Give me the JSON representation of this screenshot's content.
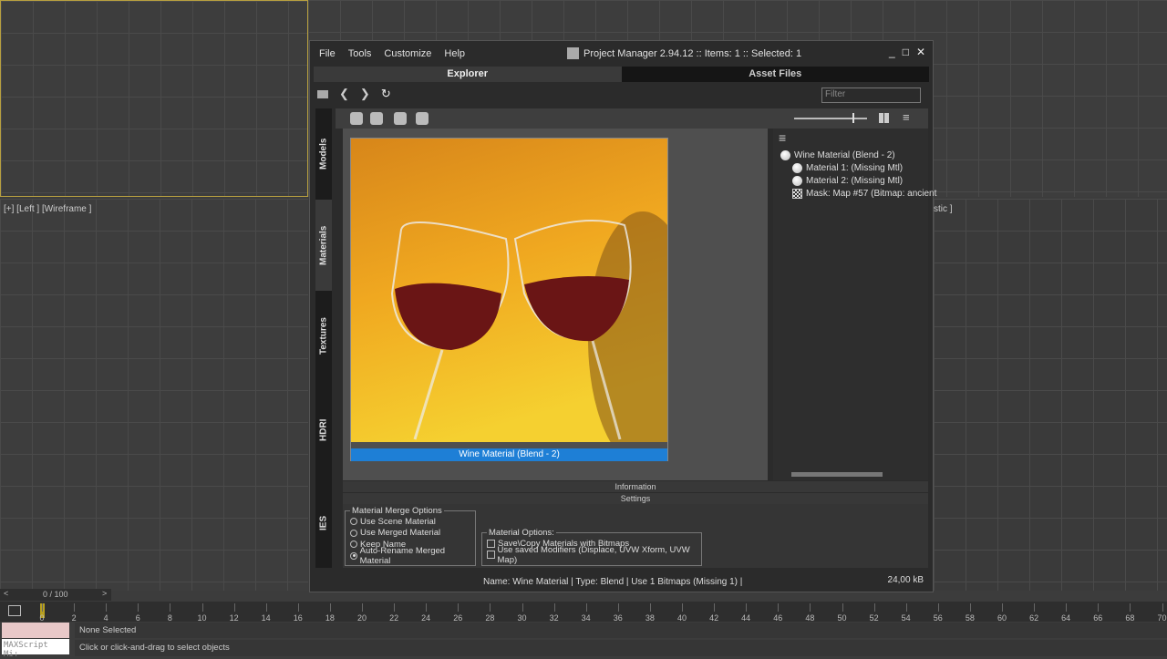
{
  "viewport": {
    "left_label": "[+] [Left ] [Wireframe ]",
    "right_label": "stic ]"
  },
  "window": {
    "menu": [
      "File",
      "Tools",
      "Customize",
      "Help"
    ],
    "title": "Project Manager 2.94.12 :: Items: 1 :: Selected: 1",
    "controls": {
      "minimize": "_",
      "maximize": "□",
      "close": "✕"
    },
    "tabs": [
      {
        "label": "Explorer",
        "active": true
      },
      {
        "label": "Asset Files",
        "active": false
      }
    ],
    "filter_placeholder": "Filter",
    "side_tabs": [
      "Models",
      "Materials",
      "Textures",
      "HDRI",
      "IES"
    ],
    "active_side_tab": "Materials",
    "thumbnail": {
      "label": "Wine Material (Blend - 2)"
    },
    "tree": [
      {
        "label": "Wine Material (Blend - 2)",
        "icon": "material-ball-icon",
        "level": 0
      },
      {
        "label": "Material 1:  (Missing Mtl)",
        "icon": "material-ball-icon",
        "level": 1
      },
      {
        "label": "Material 2:  (Missing Mtl)",
        "icon": "material-ball-icon",
        "level": 1
      },
      {
        "label": "Mask: Map #57 (Bitmap: ancient",
        "icon": "checker-map-icon",
        "level": 1
      }
    ],
    "panels": {
      "information": "Information",
      "settings": "Settings"
    },
    "merge_options": {
      "title": "Material  Merge Options",
      "options": [
        {
          "label": "Use Scene Material",
          "checked": false
        },
        {
          "label": "Use Merged Material",
          "checked": false
        },
        {
          "label": "Keep Name",
          "checked": false
        },
        {
          "label": "Auto-Rename Merged Material",
          "checked": true
        }
      ]
    },
    "material_options": {
      "title": "Material Options:",
      "options": [
        {
          "label": "Save\\Copy Materials with Bitmaps",
          "checked": false
        },
        {
          "label": "Use saved Modifiers (Displace, UVW Xform, UVW Map)",
          "checked": false
        }
      ]
    },
    "status": "Name: Wine Material | Type: Blend | Use 1 Bitmaps (Missing 1)  |",
    "size": "24,00 kB"
  },
  "timeslider": {
    "value": "0 / 100",
    "prev": "<",
    "next": ">"
  },
  "timeline_ticks": [
    0,
    2,
    4,
    6,
    8,
    10,
    12,
    14,
    16,
    18,
    20,
    22,
    24,
    26,
    28,
    30,
    32,
    34,
    36,
    38,
    40,
    42,
    44,
    46,
    48,
    50,
    52,
    54,
    56,
    58,
    60,
    62,
    64,
    66,
    68,
    70
  ],
  "statusbar": {
    "selection": "None Selected",
    "prompt": "Click or click-and-drag to select objects",
    "maxscript": "MAXScript Mi:"
  }
}
